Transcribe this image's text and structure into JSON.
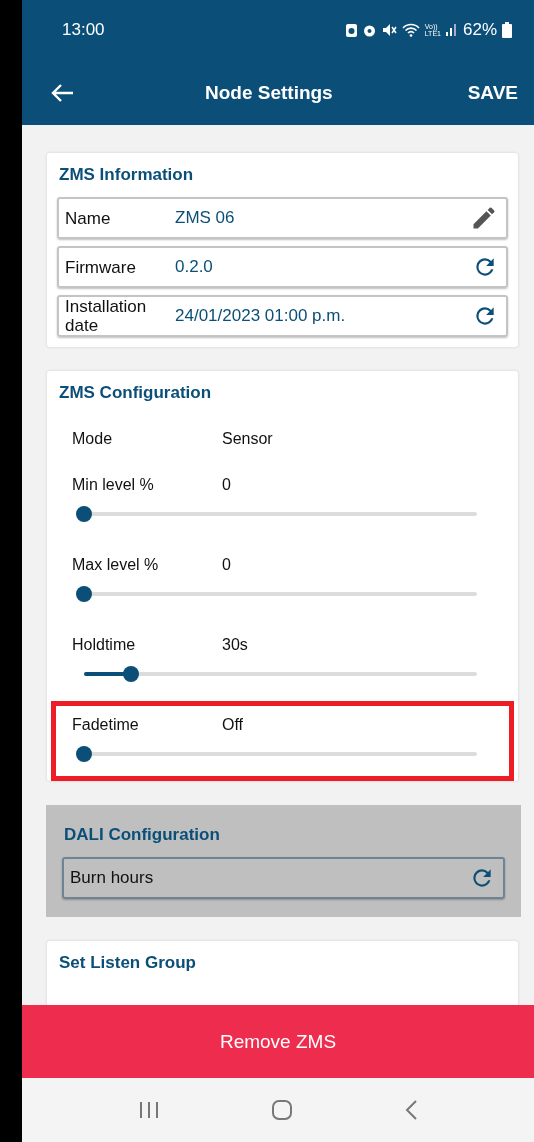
{
  "status_bar": {
    "time": "13:00",
    "network_label": [
      "Vo))",
      "LTE1"
    ],
    "battery": "62%"
  },
  "app_bar": {
    "title": "Node Settings",
    "action": "SAVE"
  },
  "info_card": {
    "title": "ZMS Information",
    "rows": [
      {
        "label": "Name",
        "value": "ZMS 06",
        "kind": "edit"
      },
      {
        "label": "Firmware",
        "value": "0.2.0",
        "kind": "refresh"
      },
      {
        "label": "Installation date",
        "value": "24/01/2023 01:00 p.m.",
        "kind": "refresh"
      }
    ]
  },
  "config_card": {
    "title": "ZMS Configuration",
    "items": [
      {
        "kind": "text",
        "label": "Mode",
        "value": "Sensor",
        "highlighted": false
      },
      {
        "kind": "slider",
        "label": "Min level %",
        "value": "0",
        "level": 0,
        "highlighted": false
      },
      {
        "kind": "slider",
        "label": "Max level %",
        "value": "0",
        "level": 0,
        "highlighted": false
      },
      {
        "kind": "slider",
        "label": "Holdtime",
        "value": "30s",
        "level": 0.12,
        "highlighted": false
      },
      {
        "kind": "slider",
        "label": "Fadetime",
        "value": "Off",
        "level": 0,
        "highlighted": true
      }
    ]
  },
  "dali_card": {
    "title": "DALI Configuration",
    "disabled": true,
    "rows": [
      {
        "label": "Burn hours",
        "kind": "refresh"
      }
    ]
  },
  "listen_card": {
    "title": "Set Listen Group"
  },
  "remove_button": "Remove ZMS"
}
